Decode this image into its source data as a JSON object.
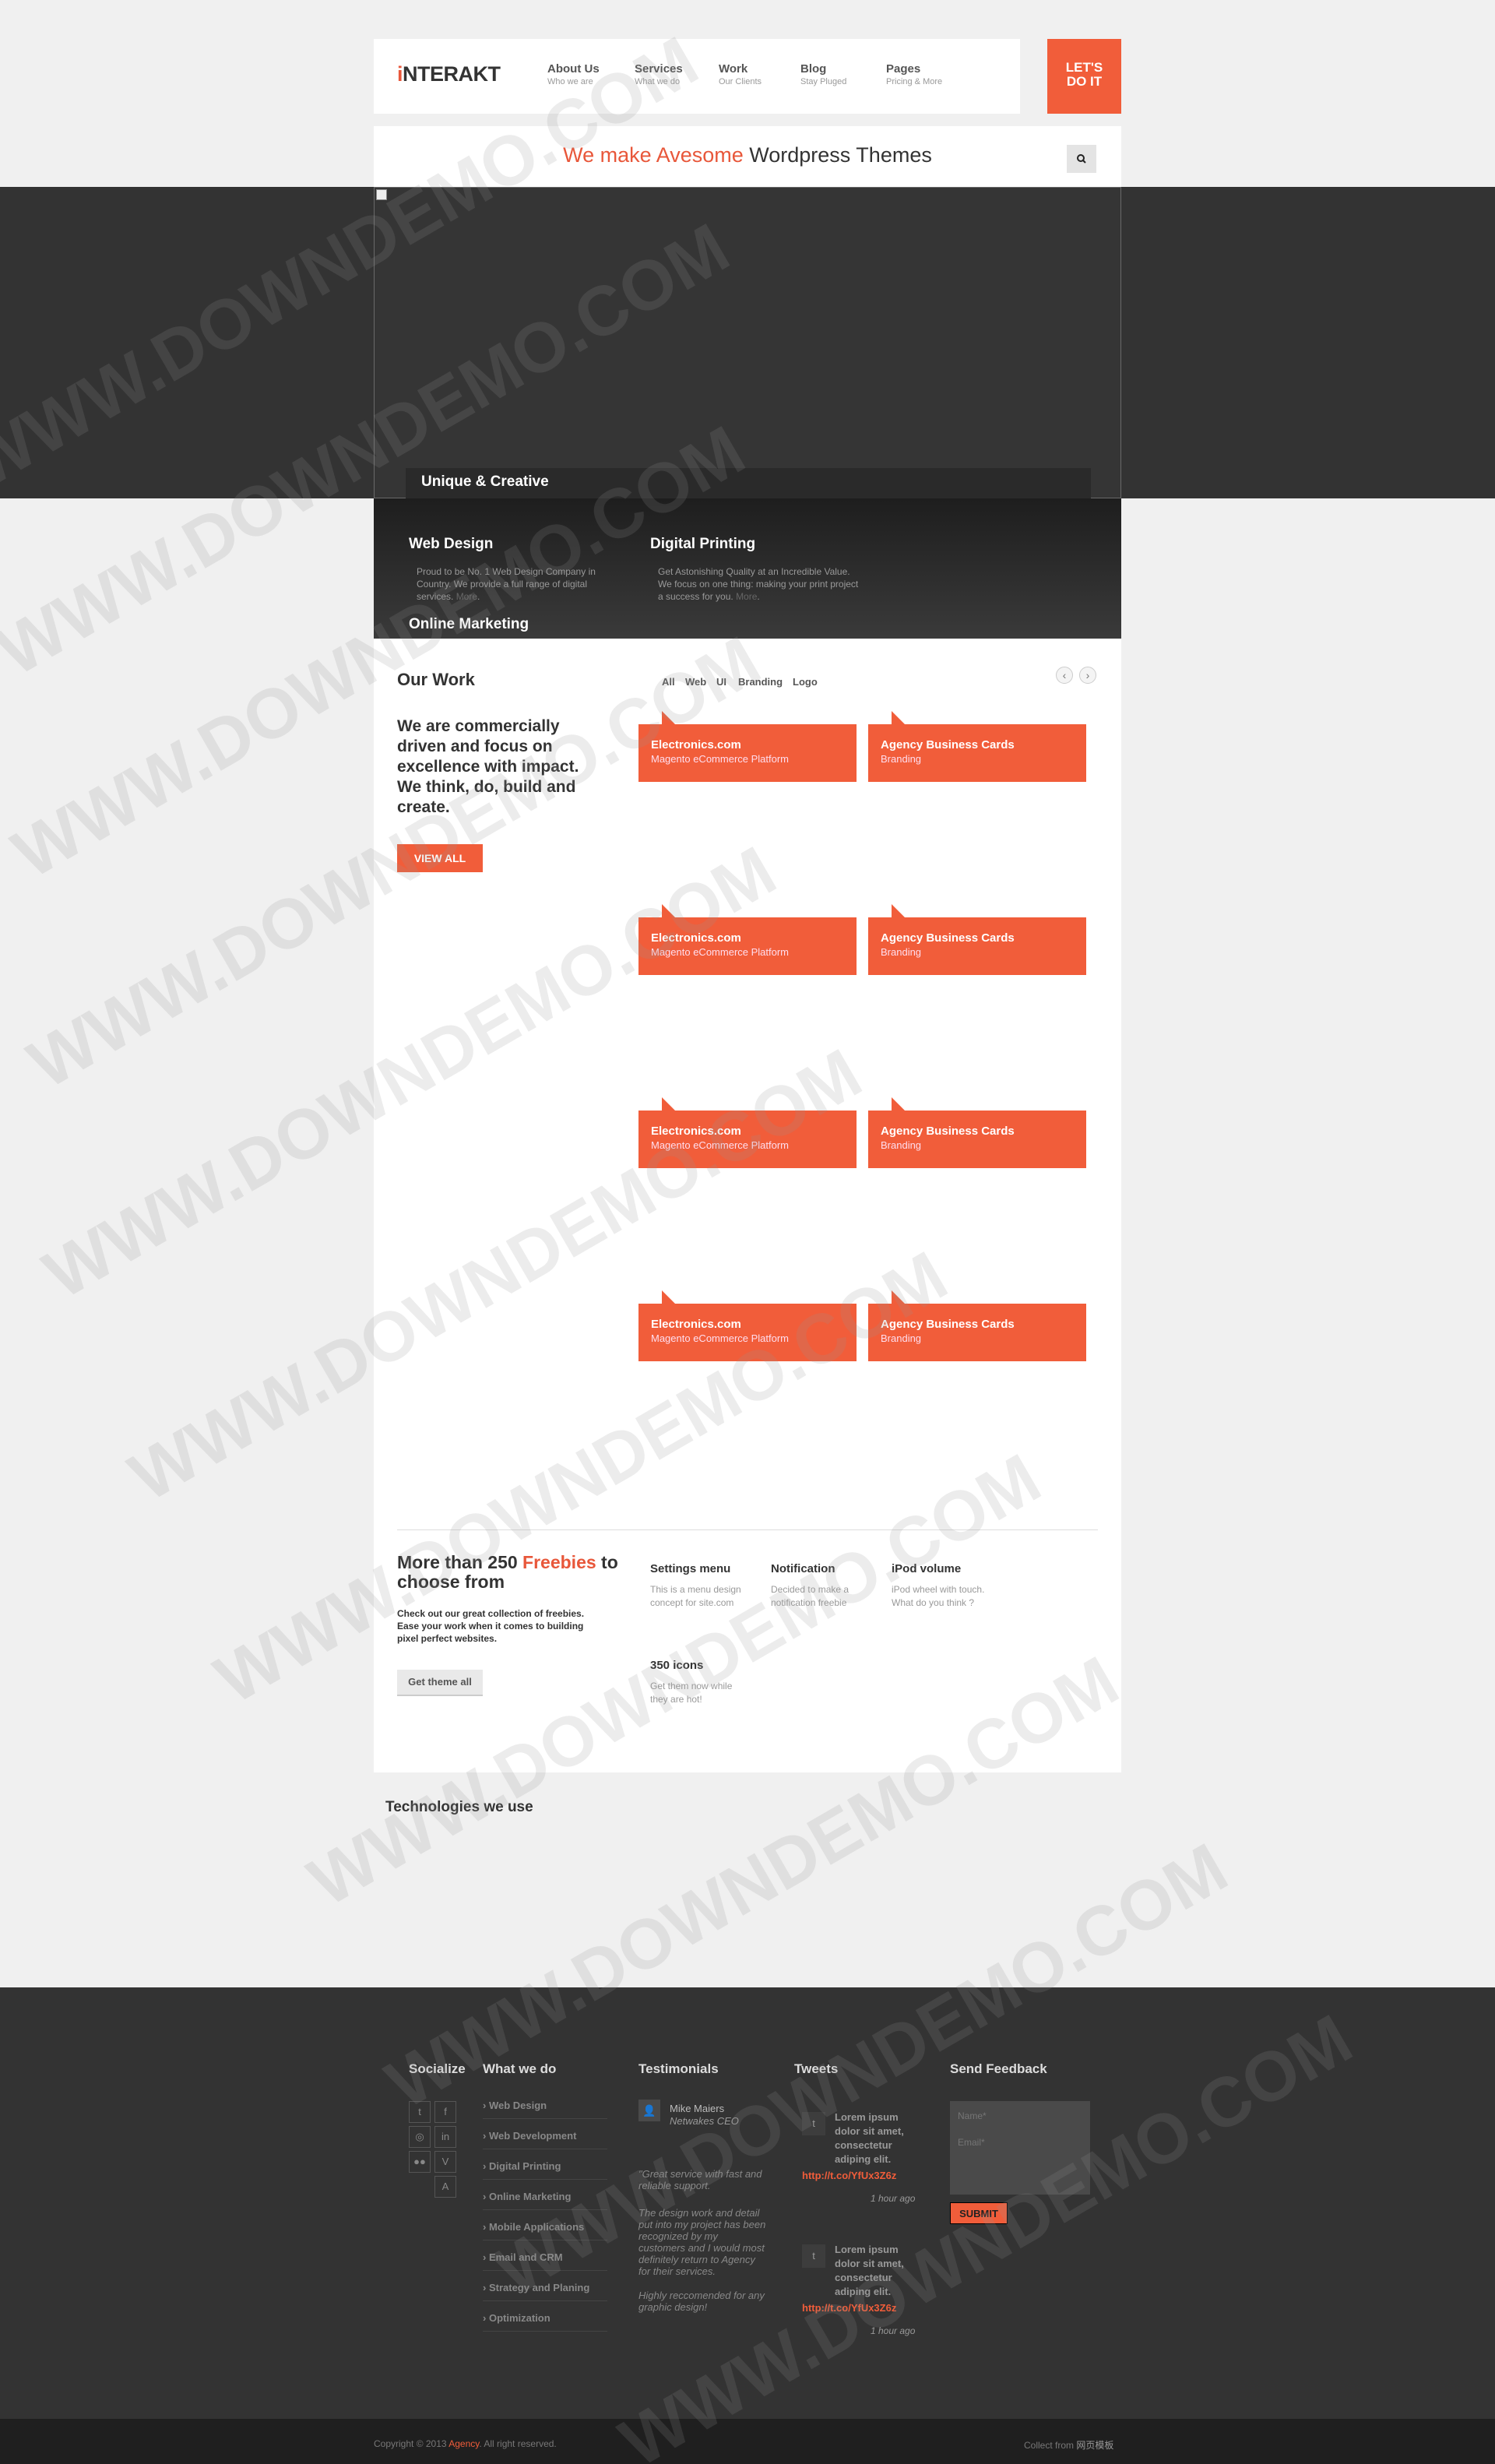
{
  "header": {
    "logo_prefix": "i",
    "logo_rest": "NTERAKT",
    "nav": [
      {
        "title": "About Us",
        "sub": "Who we are"
      },
      {
        "title": "Services",
        "sub": "What we do"
      },
      {
        "title": "Work",
        "sub": "Our Clients"
      },
      {
        "title": "Blog",
        "sub": "Stay Pluged"
      },
      {
        "title": "Pages",
        "sub": "Pricing & More"
      }
    ],
    "cta_line1": "LET'S",
    "cta_line2": "DO IT"
  },
  "tagline": {
    "accent": "We make Avesome",
    "rest": " Wordpress Themes"
  },
  "slider": {
    "caption": "Unique & Creative"
  },
  "services": [
    {
      "title": "Web Design",
      "text": "Proud to be No. 1 Web Design Company in Country. We provide a full range of digital services.",
      "more": "More"
    },
    {
      "title": "Digital Printing",
      "text": "Get Astonishing Quality at an Incredible Value. We focus on one thing: making your print project a success for you.",
      "more": "More"
    },
    {
      "title": "Online Marketing"
    }
  ],
  "work": {
    "title": "Our Work",
    "filters": [
      "All",
      "Web",
      "UI",
      "Branding",
      "Logo"
    ],
    "prev": "‹",
    "next": "›",
    "lead": "We are commercially driven and focus on excellence with impact. We think, do, build and create.",
    "view_all": "VIEW ALL",
    "cards": [
      {
        "title": "Electronics.com",
        "sub": "Magento eCommerce Platform"
      },
      {
        "title": "Agency Business Cards",
        "sub": "Branding"
      },
      {
        "title": "Electronics.com",
        "sub": "Magento eCommerce Platform"
      },
      {
        "title": "Agency Business Cards",
        "sub": "Branding"
      },
      {
        "title": "Electronics.com",
        "sub": "Magento eCommerce Platform"
      },
      {
        "title": "Agency Business Cards",
        "sub": "Branding"
      },
      {
        "title": "Electronics.com",
        "sub": "Magento eCommerce Platform"
      },
      {
        "title": "Agency Business Cards",
        "sub": "Branding"
      }
    ]
  },
  "freebies": {
    "title_a": "More than 250 ",
    "title_accent": "Freebies",
    "title_b": " to choose from",
    "desc": "Check out our great collection of freebies. Ease your work when it comes to building pixel perfect websites.",
    "button": "Get theme all",
    "items": [
      {
        "title": "Settings menu",
        "text": "This is a menu design concept for site.com"
      },
      {
        "title": "Notification",
        "text": "Decided to make a notification freebie"
      },
      {
        "title": "iPod volume",
        "text": "iPod wheel with touch. What do you think ?"
      },
      {
        "title": "350 icons",
        "text": "Get them now while they are hot!"
      }
    ]
  },
  "technologies": {
    "title": "Technologies we use"
  },
  "footer": {
    "socialize": "Socialize",
    "social_icons": [
      "t",
      "f",
      "◎",
      "in",
      "●●",
      "V",
      "A"
    ],
    "what_we_do": "What we do",
    "services": [
      "Web Design",
      "Web Development",
      "Digital Printing",
      "Online Marketing",
      "Mobile Applications",
      "Email and CRM",
      "Strategy and Planing",
      "Optimization"
    ],
    "testimonials": "Testimonials",
    "testimonial_name": "Mike Maiers",
    "testimonial_role": "Netwakes CEO",
    "quotes": [
      "\"Great service with fast and reliable support.",
      "The design work and detail put into my project has been recognized by my customers and I would most definitely return to Agency for their services.",
      "Highly reccomended for any graphic design!"
    ],
    "tweets_title": "Tweets",
    "tweets": [
      {
        "text": "Lorem ipsum dolor sit amet, consectetur adiping elit.",
        "link": "http://t.co/YfUx3Z6z",
        "time": "1 hour ago"
      },
      {
        "text": "Lorem ipsum dolor sit amet, consectetur adiping elit.",
        "link": "http://t.co/YfUx3Z6z",
        "time": "1 hour ago"
      }
    ],
    "feedback_title": "Send Feedback",
    "name_placeholder": "Name*",
    "email_placeholder": "Email*",
    "submit": "SUBMIT"
  },
  "bottom": {
    "copy_a": "Copyright © 2013 ",
    "copy_accent": "Agency",
    "copy_b": ". All right reserved.",
    "collect_a": "Collect from ",
    "collect_b": "网页模板"
  },
  "watermark": "WWW.DOWNDEMO.COM"
}
